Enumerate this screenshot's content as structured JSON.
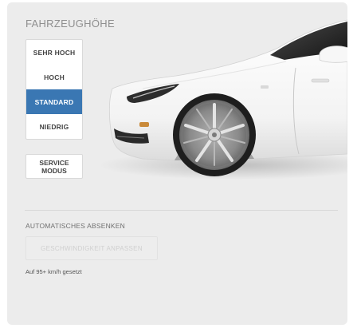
{
  "panel": {
    "title": "FAHRZEUGHÖHE"
  },
  "height_options": [
    {
      "label": "SEHR HOCH",
      "selected": false
    },
    {
      "label": "HOCH",
      "selected": false
    },
    {
      "label": "STANDARD",
      "selected": true
    },
    {
      "label": "NIEDRIG",
      "selected": false
    }
  ],
  "service_mode": {
    "line1": "SERVICE",
    "line2": "MODUS"
  },
  "auto_lower": {
    "label": "AUTOMATISCHES ABSENKEN",
    "button_label": "GESCHWINDIGKEIT ANPASSEN",
    "status": "Auf 95+ km/h gesetzt"
  },
  "colors": {
    "accent": "#3a77b3",
    "panel_bg": "#ececec",
    "car_body": "#fafafa"
  },
  "icons": {
    "vehicle": "car-side-front-icon"
  }
}
